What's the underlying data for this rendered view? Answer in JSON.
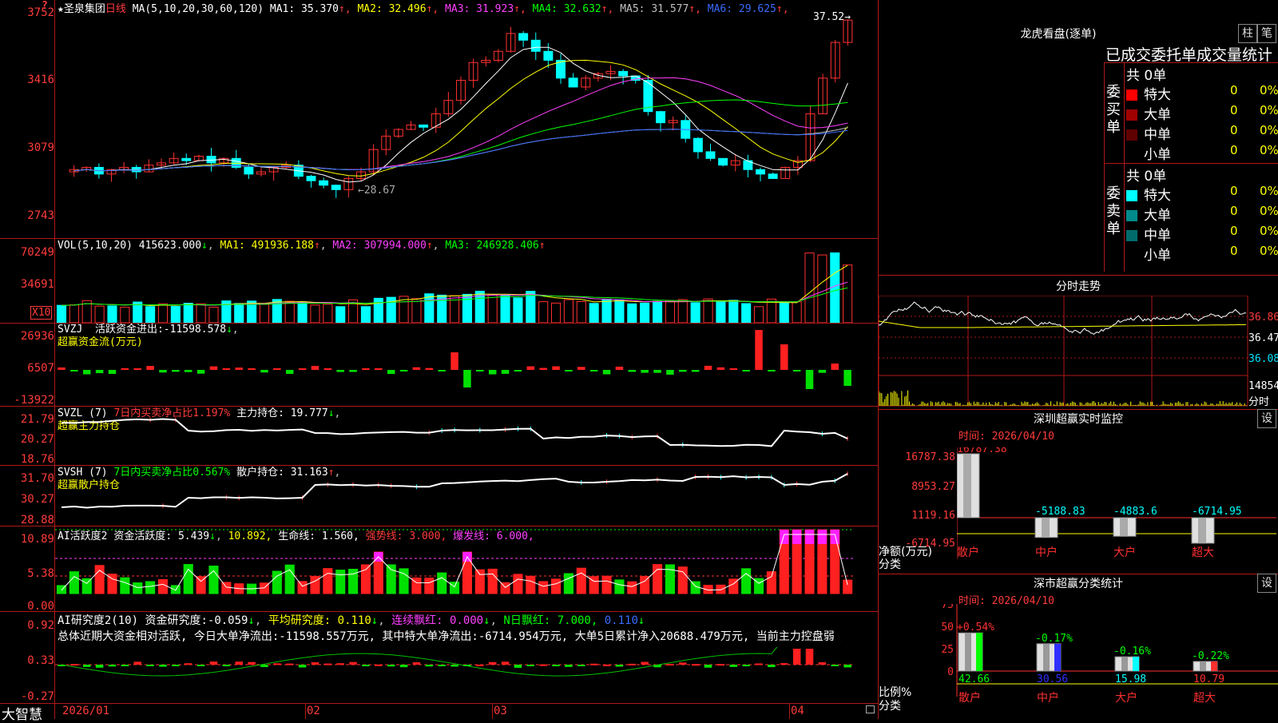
{
  "main": {
    "star": "★",
    "stock_name": "圣泉集团",
    "period": "日线",
    "ma_label": "MA(5,10,20,30,60,120)",
    "ma": [
      {
        "label": "MA1:",
        "value": "35.370",
        "arrow": "↑",
        "color": "#ffffff"
      },
      {
        "label": "MA2:",
        "value": "32.496",
        "arrow": "↑",
        "color": "#ffff00"
      },
      {
        "label": "MA3:",
        "value": "31.923",
        "arrow": "↑",
        "color": "#ff40ff"
      },
      {
        "label": "MA4:",
        "value": "32.632",
        "arrow": "↑",
        "color": "#00ff00"
      },
      {
        "label": "MA5:",
        "value": "31.577",
        "arrow": "↑",
        "color": "#c0c0c0"
      },
      {
        "label": "MA6:",
        "value": "29.625",
        "arrow": "↑",
        "color": "#3b6bff"
      }
    ],
    "y_ticks": [
      "3752",
      "3416",
      "3079",
      "2743"
    ],
    "high_mark": "37.52",
    "low_mark": "28.67",
    "marker": "?"
  },
  "vol": {
    "title": "VOL(5,10,20)",
    "value": "415623.000",
    "ma1": "491936.188",
    "ma2": "307994.000",
    "ma3": "246928.406",
    "y_ticks": [
      "70249",
      "34691"
    ],
    "unit": "X10"
  },
  "svzj": {
    "title": "SVZJ",
    "desc": "活跃资金进出:",
    "value": "-11598.578",
    "sub": "超赢资金流(万元)",
    "y_ticks": [
      "26936",
      "6507",
      "-13922"
    ]
  },
  "svzl": {
    "title": "SVZL (7)",
    "ratio": "7日内买卖净占比1.197%",
    "hold_label": "主力持仓:",
    "hold": "19.777",
    "sub": "超赢主力持仓",
    "y_ticks": [
      "21.79",
      "20.27",
      "18.76"
    ]
  },
  "svsh": {
    "title": "SVSH (7)",
    "ratio": "7日内买卖净占比0.567%",
    "hold_label": "散户持仓:",
    "hold": "31.163",
    "sub": "超赢散户持仓",
    "y_ticks": [
      "31.70",
      "30.27",
      "28.88"
    ]
  },
  "ai1": {
    "title": "AI活跃度2",
    "d1": "资金活跃度:",
    "v1": "5.439",
    "v2": "10.892,",
    "d3": "生命线:",
    "v3": "1.560,",
    "d4": "强势线:",
    "v4": "3.000,",
    "d5": "爆发线:",
    "v5": "6.000,",
    "y_ticks": [
      "10.89",
      "5.38",
      "0.00"
    ]
  },
  "ai2": {
    "title": "AI研究度2(10)",
    "d1": "资金研究度:",
    "v1": "-0.059",
    "d2": "平均研究度:",
    "v2": "0.110",
    "d3": "连续飘红:",
    "v3": "0.000",
    "d4": "N日飘红:",
    "v4": "7.000,",
    "v5": "0.110",
    "summary": "总体近期大资金相对活跃, 今日大单净流出:-11598.557万元, 其中特大单净流出:-6714.954万元, 大单5日累计净入20688.479万元, 当前主力控盘弱",
    "y_ticks": [
      "0.92",
      "0.33",
      "-0.27"
    ]
  },
  "xaxis": {
    "brand": "大智慧",
    "labels": [
      "2026/01",
      "02",
      "03",
      "04"
    ]
  },
  "right": {
    "lhb": {
      "title": "龙虎看盘(逐单)",
      "btn1": "柱",
      "btn2": "笔",
      "header": "已成交委托单成交量统计",
      "buy_label": "委买单",
      "sell_label": "委卖单",
      "buy_total": "共 0单",
      "sell_total": "共 0单",
      "buy_rows": [
        {
          "name": "特大",
          "count": "0",
          "pct": "0%",
          "color": "#ff0000"
        },
        {
          "name": "大单",
          "count": "0",
          "pct": "0%",
          "color": "#a00000"
        },
        {
          "name": "中单",
          "count": "0",
          "pct": "0%",
          "color": "#600000"
        },
        {
          "name": "小单",
          "count": "0",
          "pct": "0%",
          "color": ""
        }
      ],
      "sell_rows": [
        {
          "name": "特大",
          "count": "0",
          "pct": "0%",
          "color": "#00ffff"
        },
        {
          "name": "大单",
          "count": "0",
          "pct": "0%",
          "color": "#008b8b"
        },
        {
          "name": "中单",
          "count": "0",
          "pct": "0%",
          "color": "#006b6b"
        },
        {
          "name": "小单",
          "count": "0",
          "pct": "0%",
          "color": ""
        }
      ]
    },
    "fenshi": {
      "title": "分时走势",
      "y_ticks": [
        "36.86",
        "36.47",
        "36.08"
      ],
      "vol_tick": "14854",
      "unit": "分时"
    },
    "sz_monitor": {
      "title": "深圳超赢实时监控",
      "btn": "设",
      "time": "时间: 2026/04/10",
      "y_ticks": [
        "16787.38",
        "8953.27",
        "1119.16",
        "-6714.95"
      ],
      "ylabel": "净额(万元)",
      "xlabel": "分类",
      "bar_labels": [
        "16787.38",
        "-5188.83",
        "-4883.6",
        "-6714.95"
      ],
      "categories": [
        "散户",
        "中户",
        "大户",
        "超大"
      ]
    },
    "sz_class": {
      "title": "深市超赢分类统计",
      "btn": "设",
      "time": "时间: 2026/04/10",
      "y_ticks": [
        "75",
        "50",
        "25",
        "0"
      ],
      "ylabel": "比例%",
      "xlabel": "分类",
      "bar_top_labels": [
        "+0.54%",
        "-0.17%",
        "-0.16%",
        "-0.22%"
      ],
      "bar_values": [
        "42.66",
        "30.56",
        "15.98",
        "10.79"
      ],
      "categories": [
        "散户",
        "中户",
        "大户",
        "超大"
      ]
    }
  },
  "chart_data": [
    {
      "type": "candlestick",
      "title": "圣泉集团 日线",
      "ylim": [
        27.43,
        37.52
      ],
      "x": [
        "2026/01",
        "02",
        "03",
        "04"
      ],
      "close_start": 30.5,
      "close_end": 37.2,
      "high": 37.52,
      "low": 28.67
    },
    {
      "type": "bar",
      "title": "超赢分类统计",
      "categories": [
        "散户",
        "中户",
        "大户",
        "超大"
      ],
      "values": [
        42.66,
        30.56,
        15.98,
        10.79
      ],
      "ylabel": "比例%",
      "ylim": [
        0,
        75
      ]
    },
    {
      "type": "bar",
      "title": "深圳超赢实时监控",
      "categories": [
        "散户",
        "中户",
        "大户",
        "超大"
      ],
      "values": [
        16787.38,
        -5188.83,
        -4883.6,
        -6714.95
      ],
      "ylabel": "净额(万元)"
    }
  ]
}
